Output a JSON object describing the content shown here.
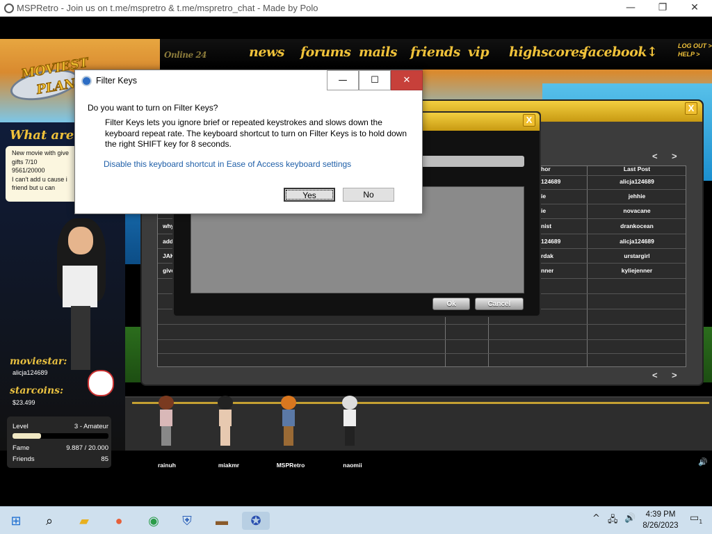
{
  "window": {
    "title": "MSPRetro - Join us on t.me/mspretro & t.me/mspretro_chat - Made by Polo",
    "min_glyph": "—",
    "max_glyph": "❐",
    "close_glyph": "✕"
  },
  "game": {
    "logo_line1": "MOVIEST",
    "logo_line2": "PLANET",
    "online_text": "Online 24",
    "nav": [
      "news",
      "forums",
      "mails",
      "friends",
      "vip",
      "highscores",
      "facebook"
    ],
    "nav_sort_glyph": "↕",
    "logout": "LOG OUT >",
    "help": "HELP >",
    "what_are_you": "What are you",
    "bubble_lines": [
      "New movie with  give",
      "gifts 7/10",
      "9561/20000",
      "I can't add u cause i",
      "friend but u can"
    ],
    "moviestar_label": "moviestar:",
    "moviestar_name": "alicja124689",
    "starcoins_label": "starcoins:",
    "starcoins_value": "$23.499",
    "stats": {
      "level_label": "Level",
      "level_value": "3 - Amateur",
      "level_progress": 0.3,
      "fame_label": "Fame",
      "fame_value": "9.887 / 20.000",
      "friends_label": "Friends",
      "friends_value": "85"
    },
    "room_avatars": [
      "rainuh",
      "miakmr",
      "MSPRetro",
      "naomii"
    ]
  },
  "forum": {
    "close_glyph": "X",
    "prev_glyph": "<",
    "next_glyph": ">",
    "headers": {
      "author": "hor",
      "last_post": "Last Post"
    },
    "rows": [
      {
        "topic": "",
        "author": "124689",
        "last_post": "alicja124689"
      },
      {
        "topic": "",
        "author": "ie",
        "last_post": "jehhie"
      },
      {
        "topic": "",
        "author": "ie",
        "last_post": "novacane"
      },
      {
        "topic": "why",
        "author": "nist",
        "last_post": "drankocean"
      },
      {
        "topic": "add",
        "author": "124689",
        "last_post": "alicja124689"
      },
      {
        "topic": "JAK",
        "author": "rdak",
        "last_post": "urstargirl"
      },
      {
        "topic": "give",
        "author": "nner",
        "last_post": "kyliejenner"
      }
    ]
  },
  "new_topic": {
    "close_glyph": "X",
    "ok_label": "Ok",
    "cancel_label": "Cancel"
  },
  "filter_keys": {
    "title": "Filter Keys",
    "min_glyph": "—",
    "max_glyph": "☐",
    "close_glyph": "✕",
    "question": "Do you want to turn on Filter Keys?",
    "description": "Filter Keys lets you ignore brief or repeated keystrokes and slows down the keyboard repeat rate.  The keyboard shortcut to turn on Filter Keys is to hold down the right SHIFT key for 8 seconds.",
    "link": "Disable this keyboard shortcut in Ease of Access keyboard settings",
    "yes_label": "Yes",
    "no_label": "No"
  },
  "taskbar": {
    "time": "4:39 PM",
    "date": "8/26/2023",
    "icons": [
      "windows-start-icon",
      "search-icon",
      "file-explorer-icon",
      "firefox-icon",
      "chrome-icon",
      "brave-shield-icon",
      "game-app-icon",
      "accessibility-icon"
    ],
    "tray_chevron": "^",
    "tray_network": "🖧",
    "tray_volume": "🔊",
    "notification_count": "1"
  }
}
